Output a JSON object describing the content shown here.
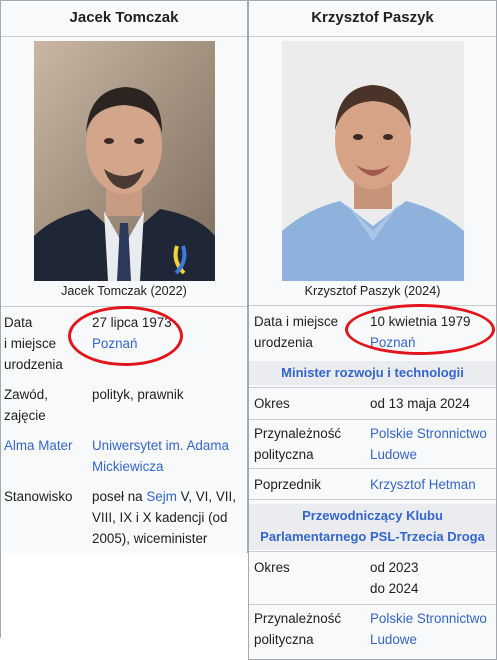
{
  "left": {
    "title": "Jacek Tomczak",
    "caption": "Jacek Tomczak (2022)",
    "rows": {
      "birth": {
        "label_lines": [
          "Data",
          "i miejsce",
          "urodzenia"
        ],
        "date": "27 lipca 1973",
        "place": "Poznań"
      },
      "occupation": {
        "label_lines": [
          "Zawód,",
          "zajęcie"
        ],
        "value": "polityk, prawnik"
      },
      "alma": {
        "label": "Alma Mater",
        "value_lines": [
          "Uniwersytet im. Adama",
          "Mickiewicza"
        ]
      },
      "position": {
        "label": "Stanowisko",
        "pre": "poseł na ",
        "link": "Sejm",
        "post": " V, VI, VII,",
        "lines": [
          "VIII, IX i X kadencji (od",
          "2005), wiceminister"
        ]
      }
    }
  },
  "right": {
    "title": "Krzysztof Paszyk",
    "caption": "Krzysztof Paszyk (2024)",
    "birth": {
      "label_lines": [
        "Data i miejsce",
        "urodzenia"
      ],
      "date": "10 kwietnia 1979",
      "place": "Poznań"
    },
    "section1": {
      "heading": "Minister rozwoju i technologii",
      "term_label": "Okres",
      "term_value": "od 13 maja 2024",
      "party_label_lines": [
        "Przynależność",
        "polityczna"
      ],
      "party_value_lines": [
        "Polskie Stronnictwo",
        "Ludowe"
      ],
      "pred_label": "Poprzednik",
      "pred_value": "Krzysztof Hetman"
    },
    "section2": {
      "heading_lines": [
        "Przewodniczący Klubu",
        "Parlamentarnego PSL-Trzecia Droga"
      ],
      "term_label": "Okres",
      "term_lines": [
        "od 2023",
        "do 2024"
      ],
      "party_label_lines": [
        "Przynależność",
        "polityczna"
      ],
      "party_value_lines": [
        "Polskie Stronnictwo",
        "Ludowe"
      ]
    }
  },
  "colors": {
    "link": "#3366cc",
    "annotation": "#e2151b",
    "border": "#a2a9b1"
  }
}
